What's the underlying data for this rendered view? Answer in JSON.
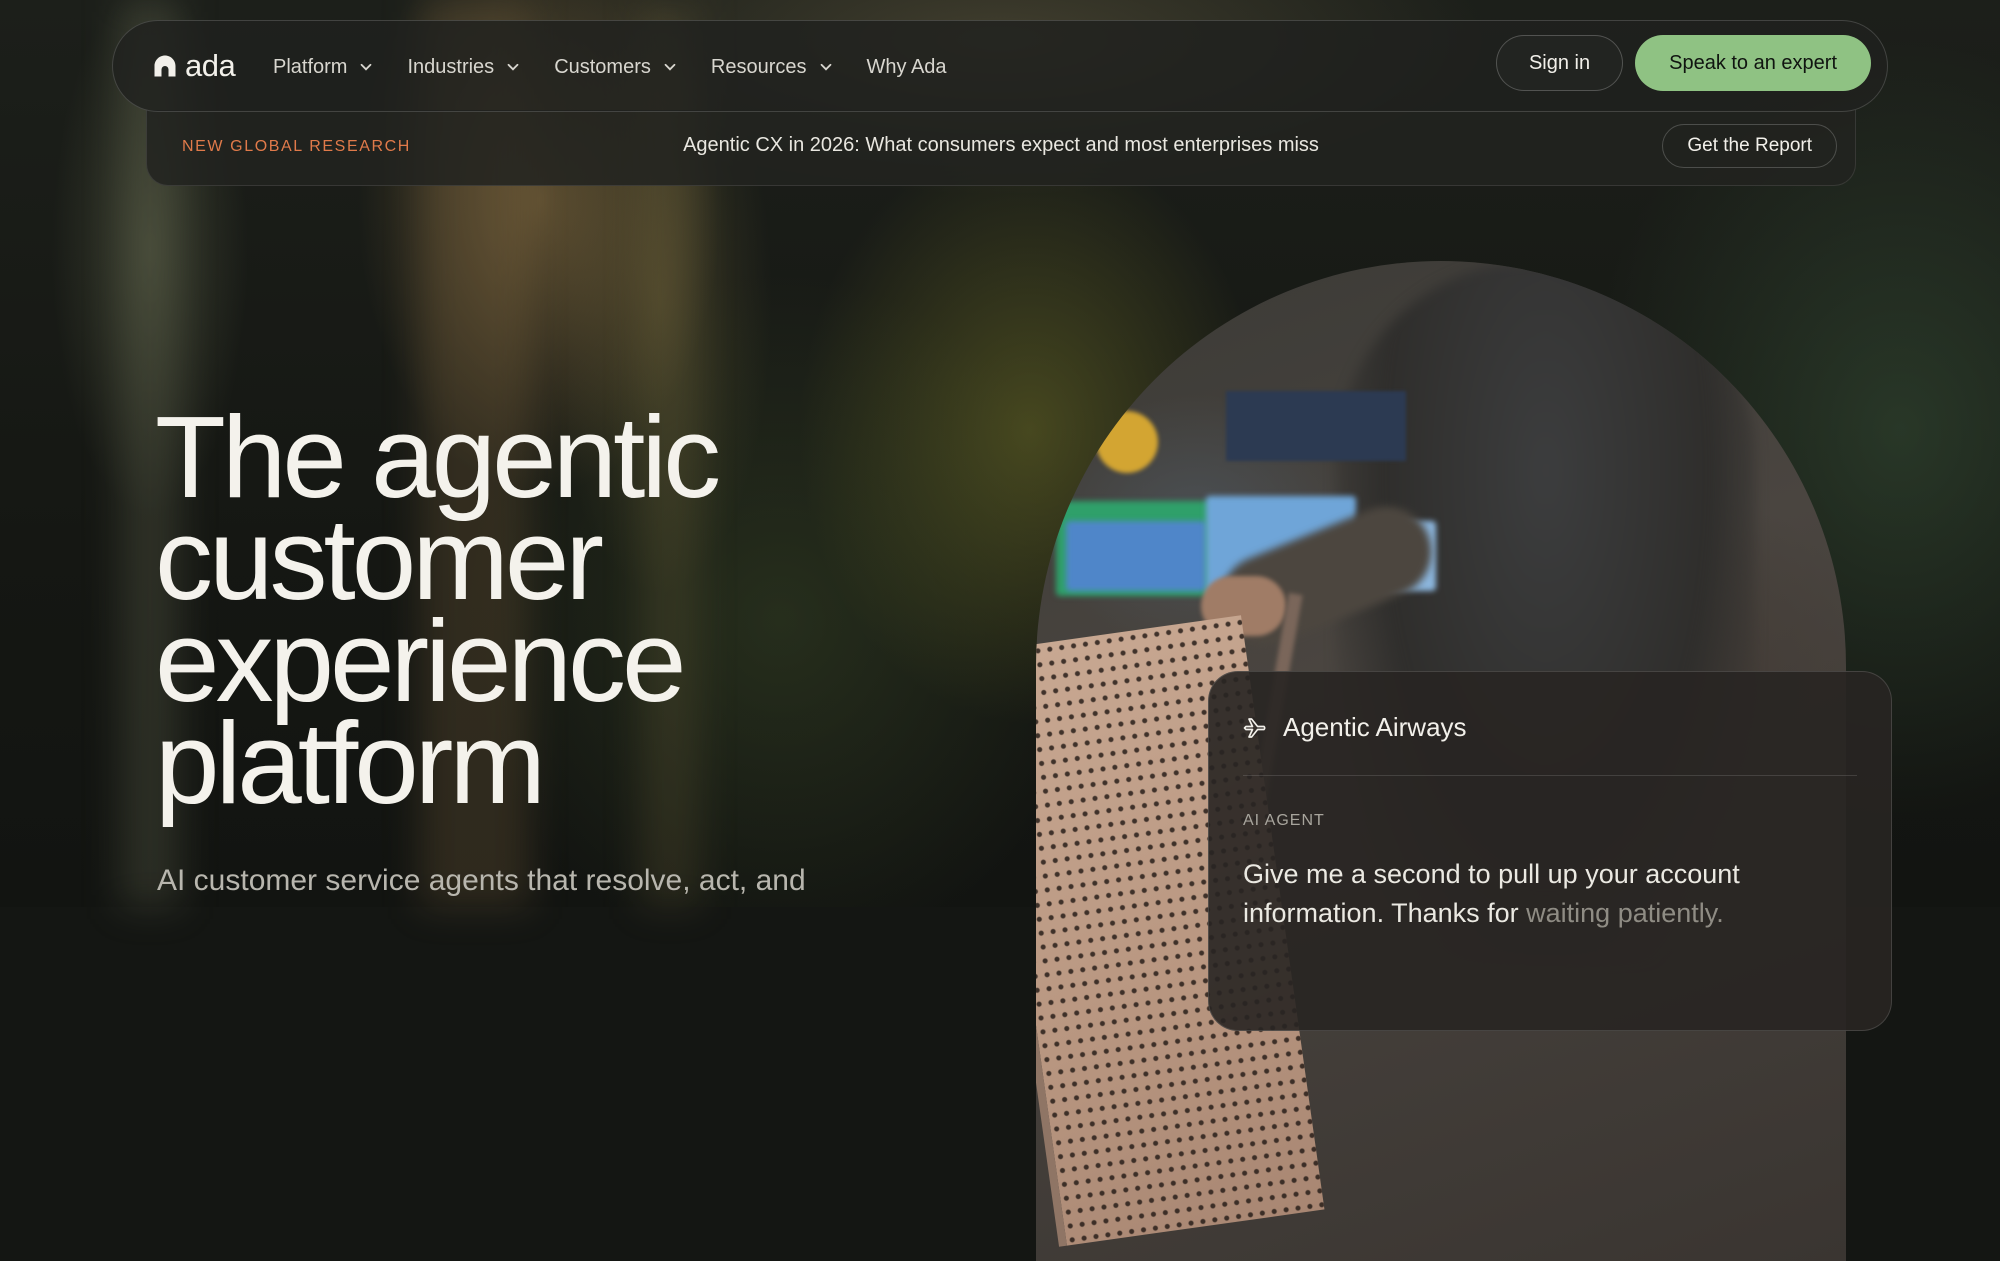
{
  "brand": {
    "name": "ada"
  },
  "nav": {
    "links": [
      {
        "label": "Platform"
      },
      {
        "label": "Industries"
      },
      {
        "label": "Customers"
      },
      {
        "label": "Resources"
      },
      {
        "label": "Why Ada"
      }
    ],
    "sign_in_label": "Sign in",
    "cta_label": "Speak to an expert"
  },
  "announcement": {
    "tag": "NEW GLOBAL RESEARCH",
    "text": "Agentic CX in 2026: What consumers expect and most enterprises miss",
    "button_label": "Get the Report"
  },
  "hero": {
    "title": "The agentic\ncustomer\nexperience\nplatform",
    "subtitle": "AI customer service agents that resolve, act, and"
  },
  "chat_card": {
    "airline_name": "Agentic Airways",
    "agent_label": "AI AGENT",
    "message_line_1": "Give me a second to pull up your account",
    "message_line_2": "information. Thanks for ",
    "message_faded": "waiting patiently."
  },
  "colors": {
    "cta_green": "#8fc283",
    "tag_orange": "#e07a4a",
    "background": "#141613"
  },
  "icons": {
    "logo": "ada-logo-mark",
    "dropdown": "chevron-down-icon",
    "airline": "airplane-icon"
  }
}
